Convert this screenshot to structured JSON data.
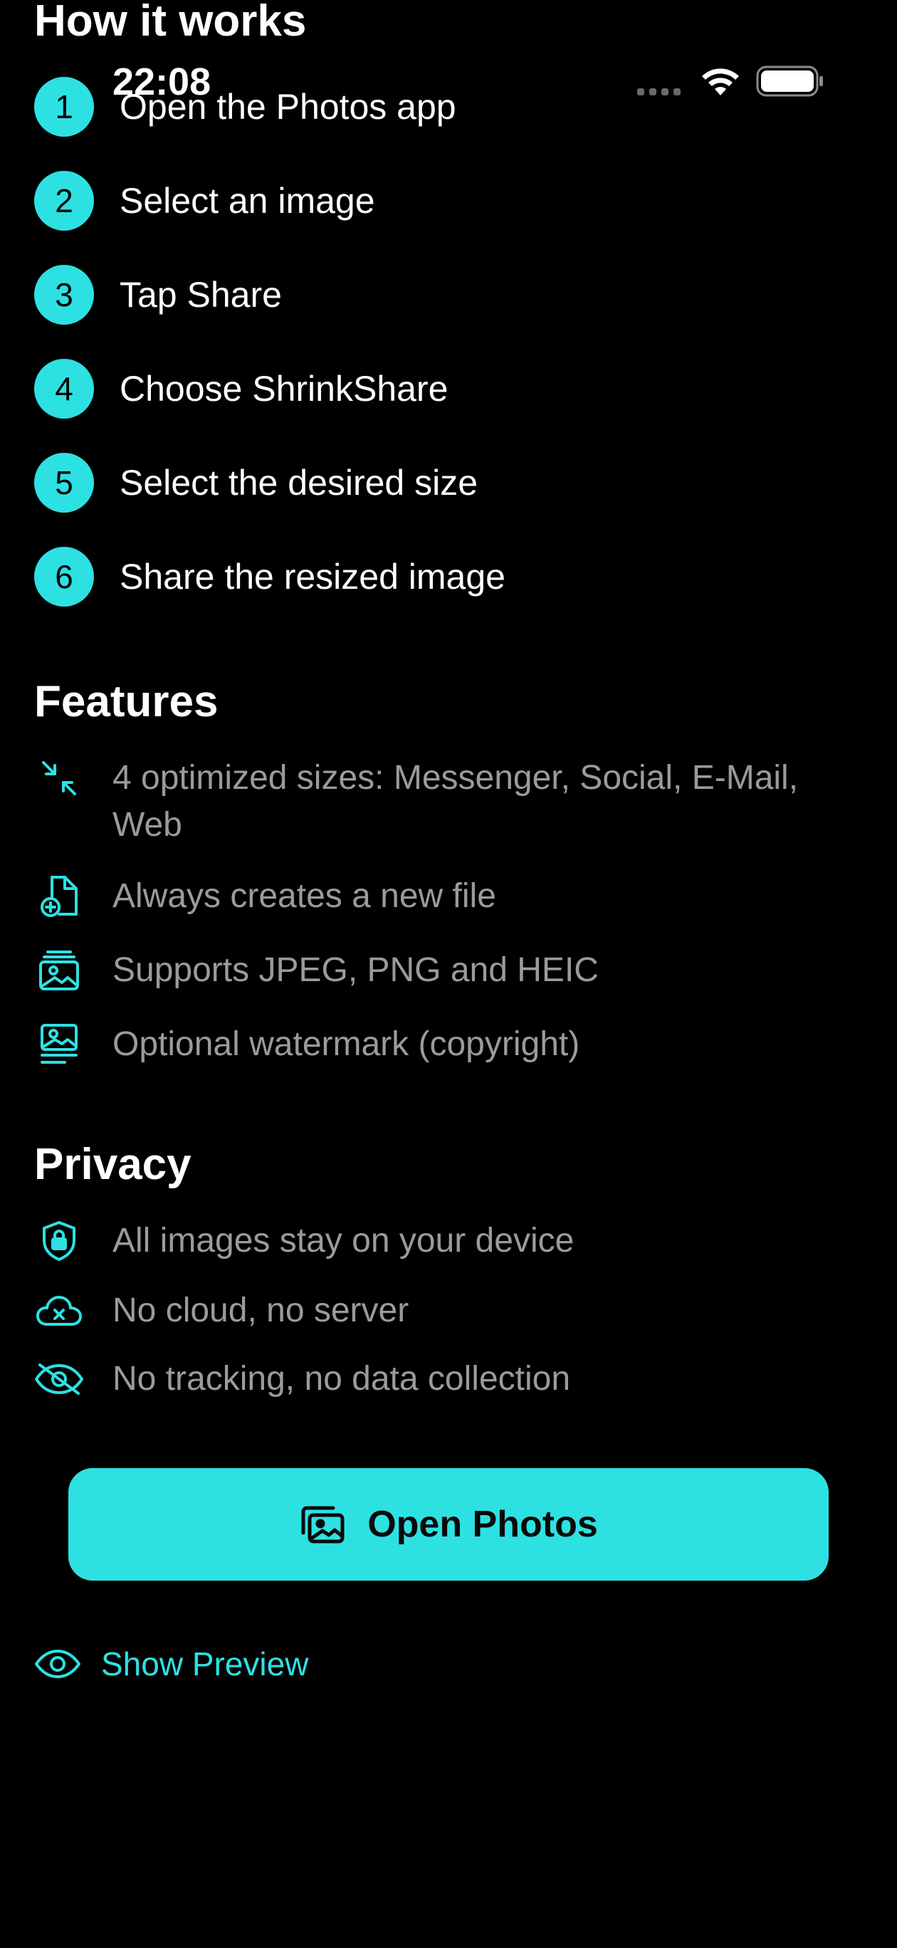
{
  "status_bar": {
    "time": "22:08",
    "wifi_icon": "wifi-icon",
    "battery_icon": "battery-icon"
  },
  "how_it_works": {
    "title": "How it works",
    "steps": [
      {
        "number": "1",
        "label": "Open the Photos app"
      },
      {
        "number": "2",
        "label": "Select an image"
      },
      {
        "number": "3",
        "label": "Tap Share"
      },
      {
        "number": "4",
        "label": "Choose ShrinkShare"
      },
      {
        "number": "5",
        "label": "Select the desired size"
      },
      {
        "number": "6",
        "label": "Share the resized image"
      }
    ]
  },
  "features": {
    "title": "Features",
    "items": [
      {
        "icon": "shrink-arrows-icon",
        "label": "4 optimized sizes: Messenger, Social, E-Mail, Web"
      },
      {
        "icon": "new-file-icon",
        "label": "Always creates a new file"
      },
      {
        "icon": "photo-stack-icon",
        "label": "Supports JPEG, PNG and HEIC"
      },
      {
        "icon": "photo-caption-icon",
        "label": "Optional watermark (copyright)"
      }
    ]
  },
  "privacy": {
    "title": "Privacy",
    "items": [
      {
        "icon": "lock-shield-icon",
        "label": "All images stay on your device"
      },
      {
        "icon": "cloud-x-icon",
        "label": "No cloud, no server"
      },
      {
        "icon": "eye-slash-icon",
        "label": "No tracking, no data collection"
      }
    ]
  },
  "actions": {
    "open_photos_label": "Open Photos",
    "open_photos_icon": "photos-icon",
    "show_preview_label": "Show Preview",
    "show_preview_icon": "eye-icon"
  },
  "colors": {
    "accent": "#2de1e3",
    "background": "#000000",
    "secondary_text": "#9b9b9f"
  }
}
